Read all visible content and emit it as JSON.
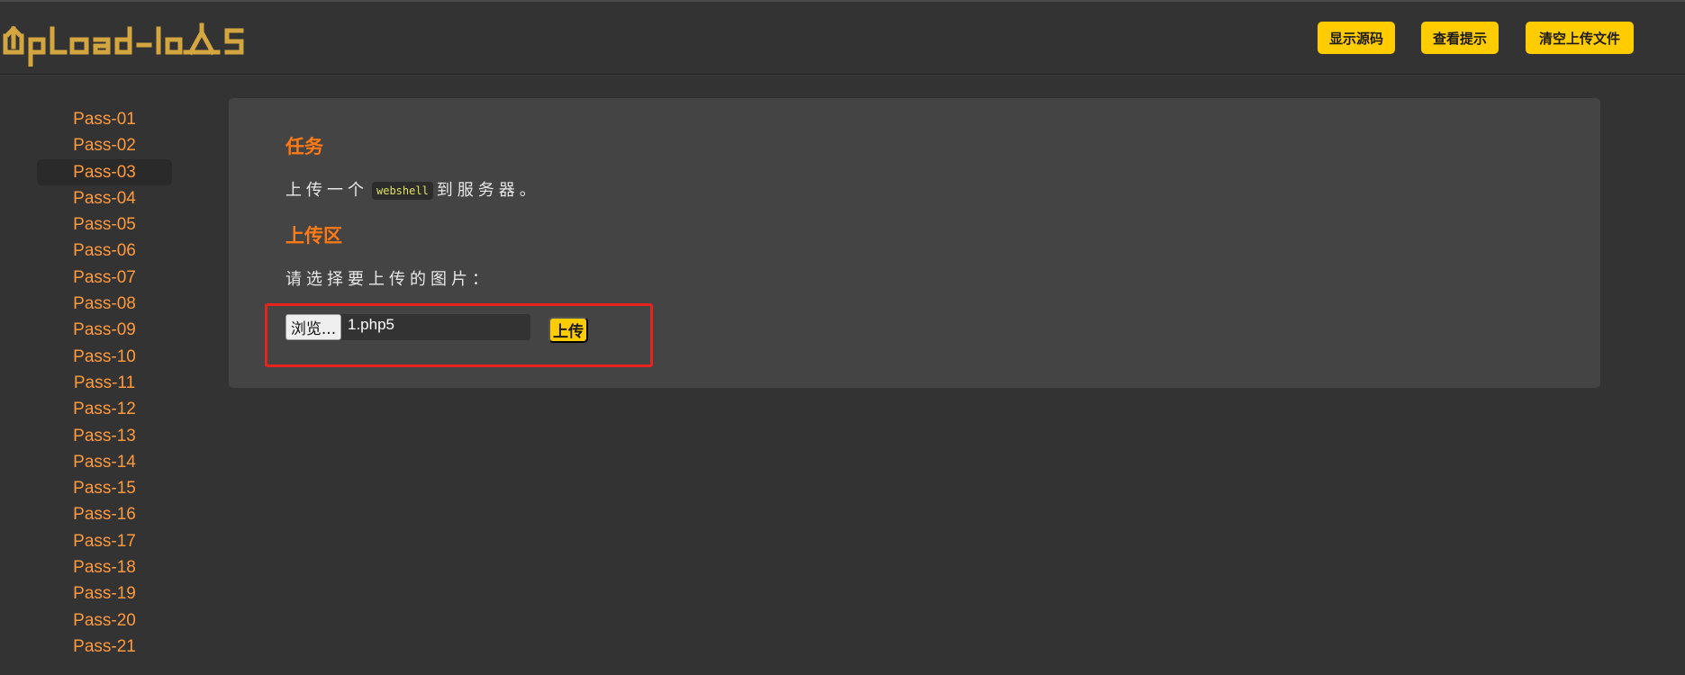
{
  "header": {
    "logo_text": "UpLoad-labs",
    "buttons": {
      "show_source": "显示源码",
      "view_hint": "查看提示",
      "clear_uploads": "清空上传文件"
    }
  },
  "sidebar": {
    "items": [
      {
        "label": "Pass-01"
      },
      {
        "label": "Pass-02"
      },
      {
        "label": "Pass-03"
      },
      {
        "label": "Pass-04"
      },
      {
        "label": "Pass-05"
      },
      {
        "label": "Pass-06"
      },
      {
        "label": "Pass-07"
      },
      {
        "label": "Pass-08"
      },
      {
        "label": "Pass-09"
      },
      {
        "label": "Pass-10"
      },
      {
        "label": "Pass-11"
      },
      {
        "label": "Pass-12"
      },
      {
        "label": "Pass-13"
      },
      {
        "label": "Pass-14"
      },
      {
        "label": "Pass-15"
      },
      {
        "label": "Pass-16"
      },
      {
        "label": "Pass-17"
      },
      {
        "label": "Pass-18"
      },
      {
        "label": "Pass-19"
      },
      {
        "label": "Pass-20"
      },
      {
        "label": "Pass-21"
      }
    ],
    "active": "Pass-03"
  },
  "main": {
    "task_title": "任务",
    "task_before": "上传一个",
    "task_code": "webshell",
    "task_after": "到服务器。",
    "upload_title": "上传区",
    "prompt": "请选择要上传的图片：",
    "browse_label": "浏览...",
    "file_name": "1.php5",
    "upload_label": "上传"
  },
  "colors": {
    "accent_orange": "#ff7a14",
    "button_yellow": "#ffcc00",
    "highlight_red": "#e8231d"
  }
}
